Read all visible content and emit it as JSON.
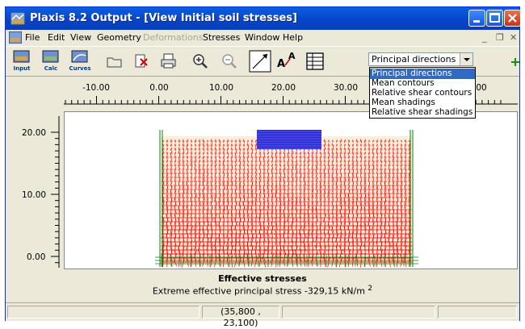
{
  "window": {
    "title": "Plaxis 8.2 Output - [View Initial soil stresses]"
  },
  "menu": [
    "File",
    "Edit",
    "View",
    "Geometry",
    "Deformations",
    "Stresses",
    "Window",
    "Help"
  ],
  "menu_disabled": [
    "Deformations"
  ],
  "toolbar": {
    "input_label": "Input",
    "calc_label": "Calc",
    "curves_label": "Curves",
    "combo_value": "Principal directions"
  },
  "dropdown": {
    "options": [
      "Principal directions",
      "Mean contours",
      "Relative shear contours",
      "Mean shadings",
      "Relative shear shadings"
    ],
    "selected": "Principal directions"
  },
  "ruler_x": [
    "-10.00",
    "0.00",
    "10.00",
    "20.00",
    "30.00",
    "00"
  ],
  "ruler_y": [
    "20.00",
    "10.00",
    "0.00"
  ],
  "caption": {
    "title": "Effective stresses",
    "subtitle": "Extreme effective principal stress -329,15 kN/m",
    "superscript": "2"
  },
  "status": {
    "coords": "(35,800 , 23,100)"
  },
  "colors": {
    "stress": "#ff0000",
    "mesh_lines": "#008000",
    "load": "#2b2bd4",
    "soil": "#fbeedb"
  }
}
